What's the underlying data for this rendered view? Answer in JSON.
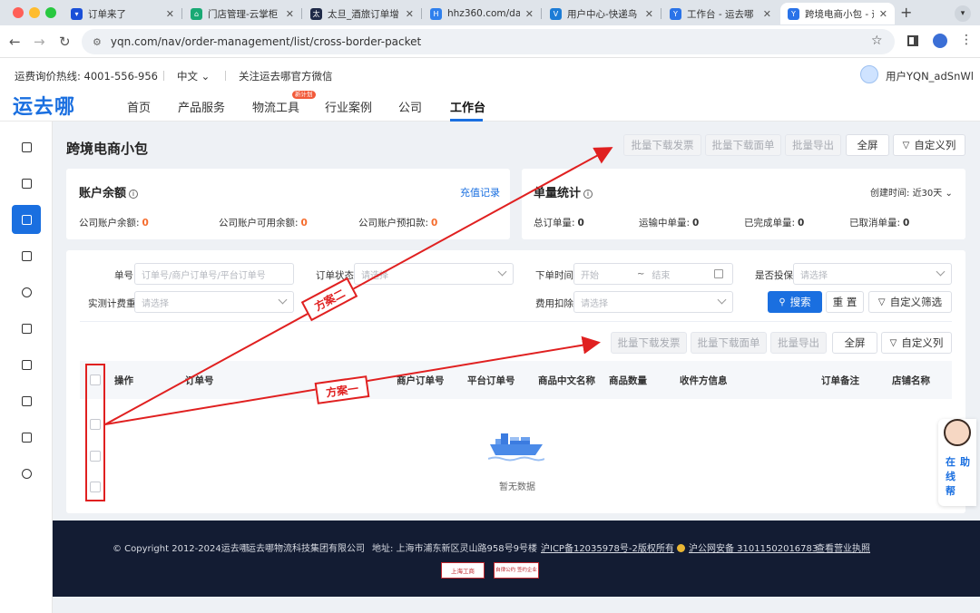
{
  "browser": {
    "tabs": [
      {
        "label": "订单来了",
        "color": "#1a4fd8"
      },
      {
        "label": "门店管理-云掌柜",
        "color": "#19a974"
      },
      {
        "label": "太旦_酒旅订单增",
        "color": "#1f2a48"
      },
      {
        "label": "hhz360.com/da/",
        "color": "#2f80ed"
      },
      {
        "label": "用户中心-快递鸟",
        "color": "#1c7cd6"
      },
      {
        "label": "工作台 - 运去哪",
        "color": "#2a73e8"
      },
      {
        "label": "跨境电商小包 - 运",
        "color": "#2a73e8"
      }
    ],
    "url": "yqn.com/nav/order-management/list/cross-border-packet"
  },
  "header": {
    "hotline": "运费询价热线: 4001-556-956",
    "lang": "中文",
    "follow": "关注运去哪官方微信",
    "username": "用户YQN_adSnWl"
  },
  "nav": {
    "logo": "运去哪",
    "items": [
      "首页",
      "产品服务",
      "物流工具",
      "行业案例",
      "公司",
      "工作台"
    ],
    "badge": "新计划"
  },
  "page": {
    "title": "跨境电商小包",
    "top_actions": [
      "批量下载发票",
      "批量下载面单",
      "批量导出",
      "全屏",
      "自定义列"
    ]
  },
  "balance": {
    "title": "账户余额",
    "link": "充值记录",
    "items": [
      {
        "label": "公司账户余额:",
        "value": "0"
      },
      {
        "label": "公司账户可用余额:",
        "value": "0"
      },
      {
        "label": "公司账户预扣款:",
        "value": "0"
      }
    ]
  },
  "stats": {
    "title": "单量统计",
    "time_label": "创建时间:",
    "time_value": "近30天",
    "items": [
      {
        "label": "总订单量:",
        "value": "0"
      },
      {
        "label": "运输中单量:",
        "value": "0"
      },
      {
        "label": "已完成单量:",
        "value": "0"
      },
      {
        "label": "已取消单量:",
        "value": "0"
      }
    ]
  },
  "filters": {
    "order_no_label": "单号",
    "order_no_placeholder": "订单号/商户订单号/平台订单号",
    "status_label": "订单状态",
    "status_placeholder": "请选择",
    "time_label": "下单时间",
    "time_start": "开始",
    "time_sep": "~",
    "time_end": "结束",
    "insure_label": "是否投保",
    "insure_placeholder": "请选择",
    "weight_label": "实测计费重",
    "weight_placeholder": "请选择",
    "fee_label": "费用扣除",
    "fee_placeholder": "请选择",
    "search": "搜索",
    "reset": "重 置",
    "custom_filter": "自定义筛选"
  },
  "table": {
    "actions": [
      "批量下载发票",
      "批量下载面单",
      "批量导出",
      "全屏",
      "自定义列"
    ],
    "columns": [
      "操作",
      "订单号",
      "商户订单号",
      "平台订单号",
      "商品中文名称",
      "商品数量",
      "收件方信息",
      "订单备注",
      "店铺名称"
    ],
    "empty": "暂无数据"
  },
  "annotations": {
    "plan1": "方案一",
    "plan2": "方案二",
    "color": "#e02020"
  },
  "helper": {
    "col1": "在线帮",
    "col2": "助"
  },
  "footer": {
    "copyright": "© Copyright 2012-2024运去哪",
    "company": "运去哪物流科技集团有限公司",
    "address": "地址: 上海市浦东新区灵山路958号9号楼",
    "icp": "沪ICP备12035978号-2版权所有",
    "police": "沪公网安备 31011502016783",
    "license": "查看营业执照",
    "badge1": "上海工商",
    "badge2": "自律公约 签约企业"
  },
  "colors": {
    "brand": "#1a6fe0",
    "warning": "#f56c2d",
    "footer_bg": "#131c33"
  }
}
